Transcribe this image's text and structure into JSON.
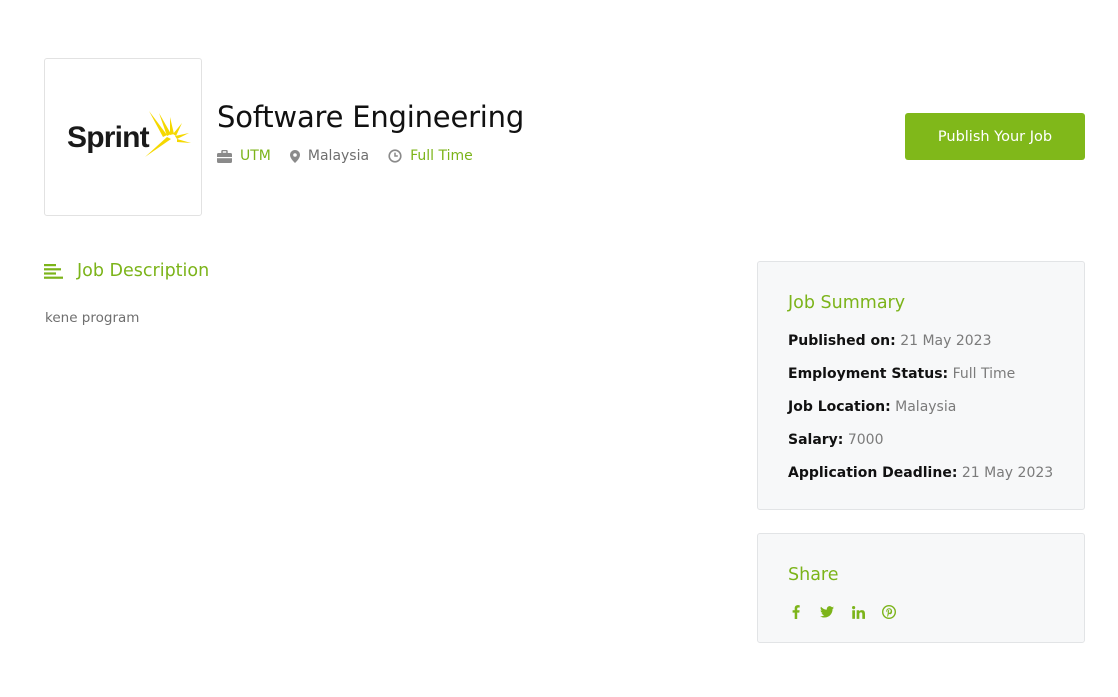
{
  "company": {
    "logo_text": "Sprint"
  },
  "job": {
    "title": "Software Engineering",
    "company": "UTM",
    "location": "Malaysia",
    "type": "Full Time"
  },
  "actions": {
    "publish_label": "Publish Your Job"
  },
  "description": {
    "heading": "Job Description",
    "text": "kene program"
  },
  "summary": {
    "title": "Job Summary",
    "items": [
      {
        "label": "Published on:",
        "value": "21 May 2023"
      },
      {
        "label": "Employment Status:",
        "value": "Full Time"
      },
      {
        "label": "Job Location:",
        "value": "Malaysia"
      },
      {
        "label": "Salary:",
        "value": "7000"
      },
      {
        "label": "Application Deadline:",
        "value": "21 May 2023"
      }
    ]
  },
  "share": {
    "title": "Share",
    "icons": [
      "facebook-icon",
      "twitter-icon",
      "linkedin-icon",
      "pinterest-icon"
    ]
  },
  "colors": {
    "accent": "#80b81a",
    "card_bg": "#f7f8f9"
  }
}
